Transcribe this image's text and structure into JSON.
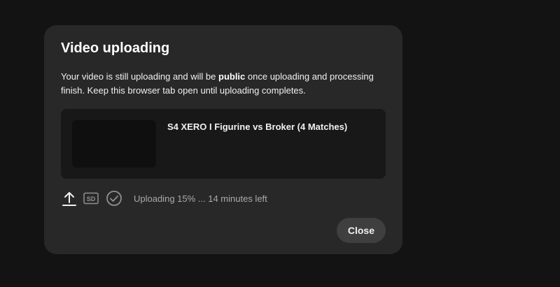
{
  "dialog": {
    "title": "Video uploading",
    "description_pre": "Your video is still uploading and will be ",
    "description_bold": "public",
    "description_post": " once uploading and processing finish. Keep this browser tab open until uploading completes."
  },
  "video": {
    "title": "S4 XERO I Figurine vs Broker (4 Matches)"
  },
  "status": {
    "sd_badge": "SD",
    "text": "Uploading 15% ... 14 minutes left",
    "progress_percent": 15,
    "icons": [
      "upload-icon",
      "sd-badge-icon",
      "check-circle-icon"
    ]
  },
  "actions": {
    "close_label": "Close"
  },
  "colors": {
    "backdrop": "#131313",
    "dialog": "#282828",
    "card": "#181818",
    "muted_text": "#aaaaaa",
    "button": "#3f3f3f"
  }
}
